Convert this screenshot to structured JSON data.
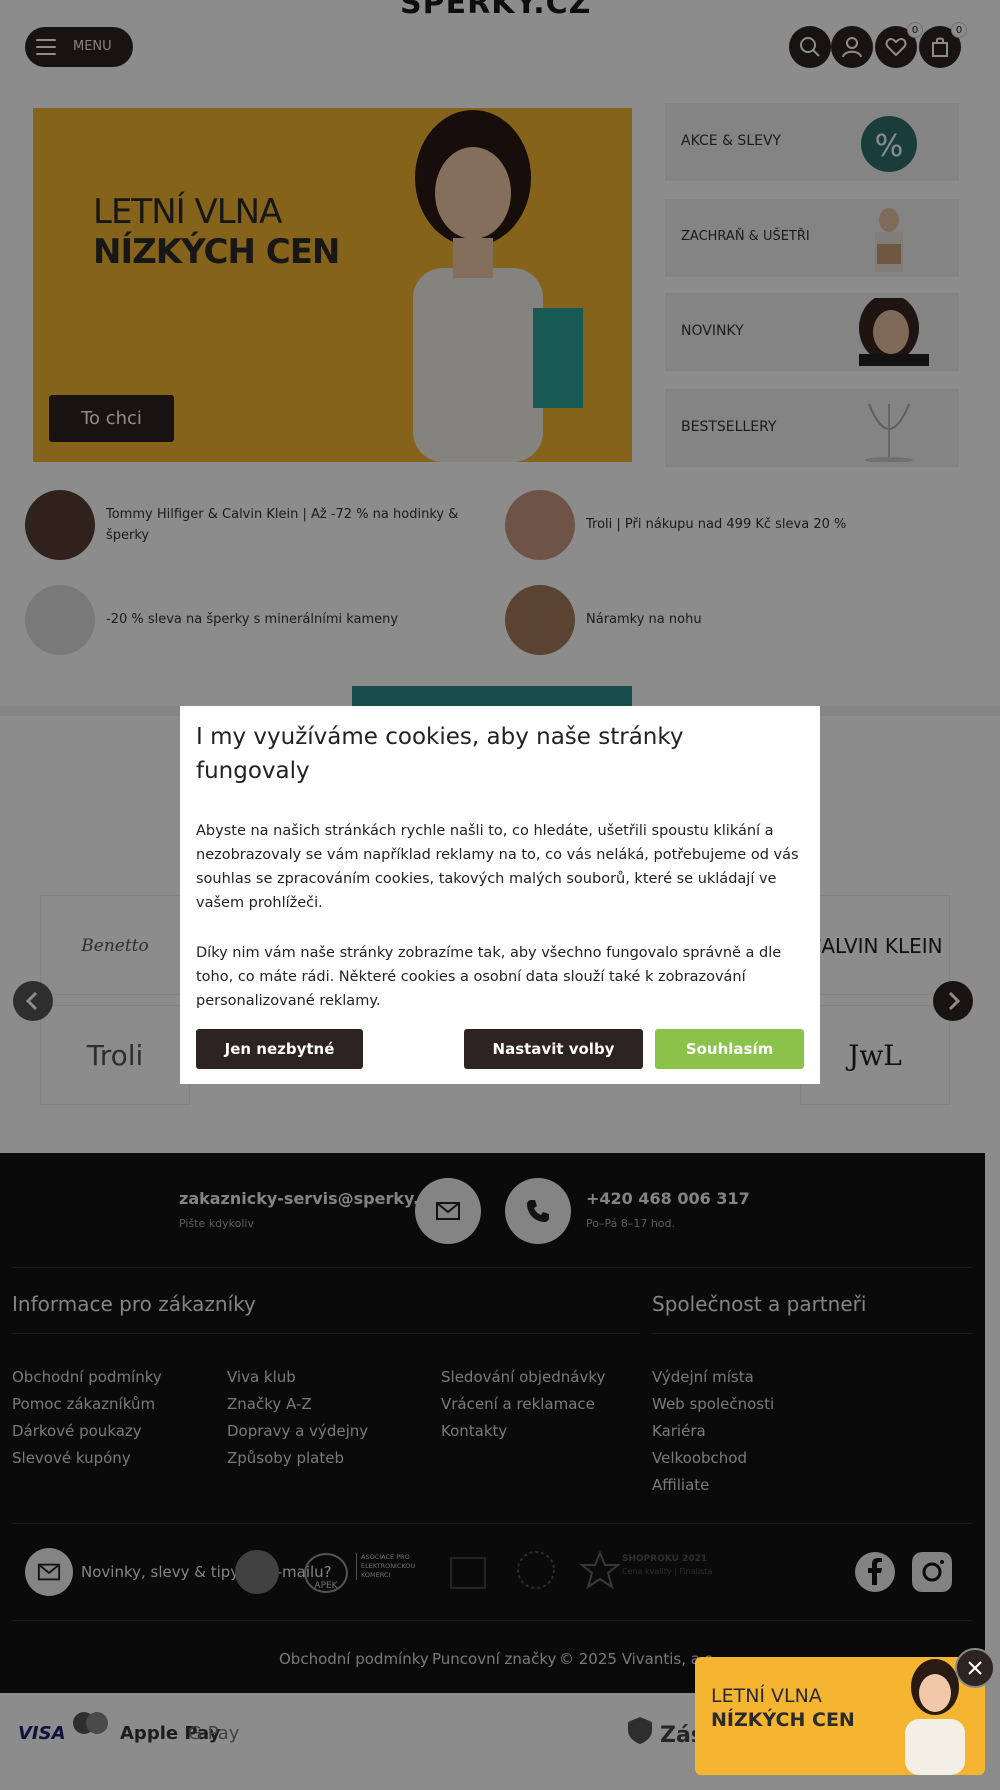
{
  "header": {
    "logo": "ŠPERKY.CZ",
    "menu_label": "MENU",
    "wishlist_count": "0",
    "cart_count": "0"
  },
  "hero": {
    "title_line1": "LETNÍ VLNA",
    "title_line2": "NÍZKÝCH CEN",
    "cta": "To chci"
  },
  "promos": [
    {
      "label": "AKCE & SLEVY"
    },
    {
      "label": "ZACHRAŇ & UŠETŘI"
    },
    {
      "label": "NOVINKY"
    },
    {
      "label": "BESTSELLERY"
    }
  ],
  "deals": [
    {
      "text_line1": "Tommy Hilfiger & Calvin Klein | Až -72 % na hodinky &",
      "text_line2": "šperky"
    },
    {
      "text_line1": "Troli | Při nákupu nad 499 Kč sleva 20 %",
      "text_line2": ""
    },
    {
      "text_line1": "-20 % sleva na šperky s minerálními kameny",
      "text_line2": ""
    },
    {
      "text_line1": "Náramky na nohu",
      "text_line2": ""
    }
  ],
  "brands": {
    "row1": [
      "Benetto",
      "",
      "",
      "",
      "CALVIN KLEIN"
    ],
    "row2": [
      "Troli",
      "",
      "",
      "",
      "JwL"
    ]
  },
  "cookie": {
    "title": "I my využíváme cookies, aby naše stránky fungovaly",
    "paragraph1": "Abyste na našich stránkách rychle našli to, co hledáte, ušetřili spoustu klikání a nezobrazovaly se vám například reklamy na to, co vás neláká, potřebujeme od vás souhlas se zpracováním cookies, takových malých souborů, které se ukládají ve vašem prohlížeči.",
    "paragraph2": "Díky nim vám naše stránky zobrazíme tak, aby všechno fungovalo správně a dle toho, co máte rádi. Některé cookies a osobní data slouží také k zobrazování personalizované reklamy.",
    "btn_necessary": "Jen nezbytné",
    "btn_settings": "Nastavit volby",
    "btn_accept": "Souhlasím",
    "accept_color": "#8bc34a"
  },
  "footer": {
    "email": "zakaznicky-servis@sperky.cz",
    "email_sub": "Pište kdykoliv",
    "phone": "+420 468 006 317",
    "phone_sub": "Po–Pá 8–17 hod.",
    "info_heading": "Informace pro zákazníky",
    "company_heading": "Společnost a partneři",
    "col1": [
      "Obchodní podmínky",
      "Pomoc zákazníkům",
      "Dárkové poukazy",
      "Slevové kupóny"
    ],
    "col2": [
      "Viva klub",
      "Značky A-Z",
      "Dopravy a výdejny",
      "Způsoby plateb"
    ],
    "col3": [
      "Sledování objednávky",
      "Vrácení a reklamace",
      "Kontakty"
    ],
    "col4": [
      "Výdejní místa",
      "Web společnosti",
      "Kariéra",
      "Velkoobchod",
      "Affiliate"
    ],
    "newsletter": "Novinky, slevy & tipy do e-mailu?",
    "apek": "APEK",
    "apek_text": "ASOCIACE PRO ELEKTRONICKOU KOMERCI",
    "shoproku": "SHOPROKU 2021",
    "shoproku_sub": "Cena kvality | Finalista",
    "bottom_links": [
      "Obchodní podmínky",
      "Puncovní značky",
      "© 2025 Vivantis, a.s."
    ]
  },
  "payments": [
    "VISA",
    "Apple Pay",
    "G Pay",
    "Zás"
  ],
  "mini_banner": {
    "line1": "LETNÍ VLNA",
    "line2": "NÍZKÝCH CEN"
  }
}
